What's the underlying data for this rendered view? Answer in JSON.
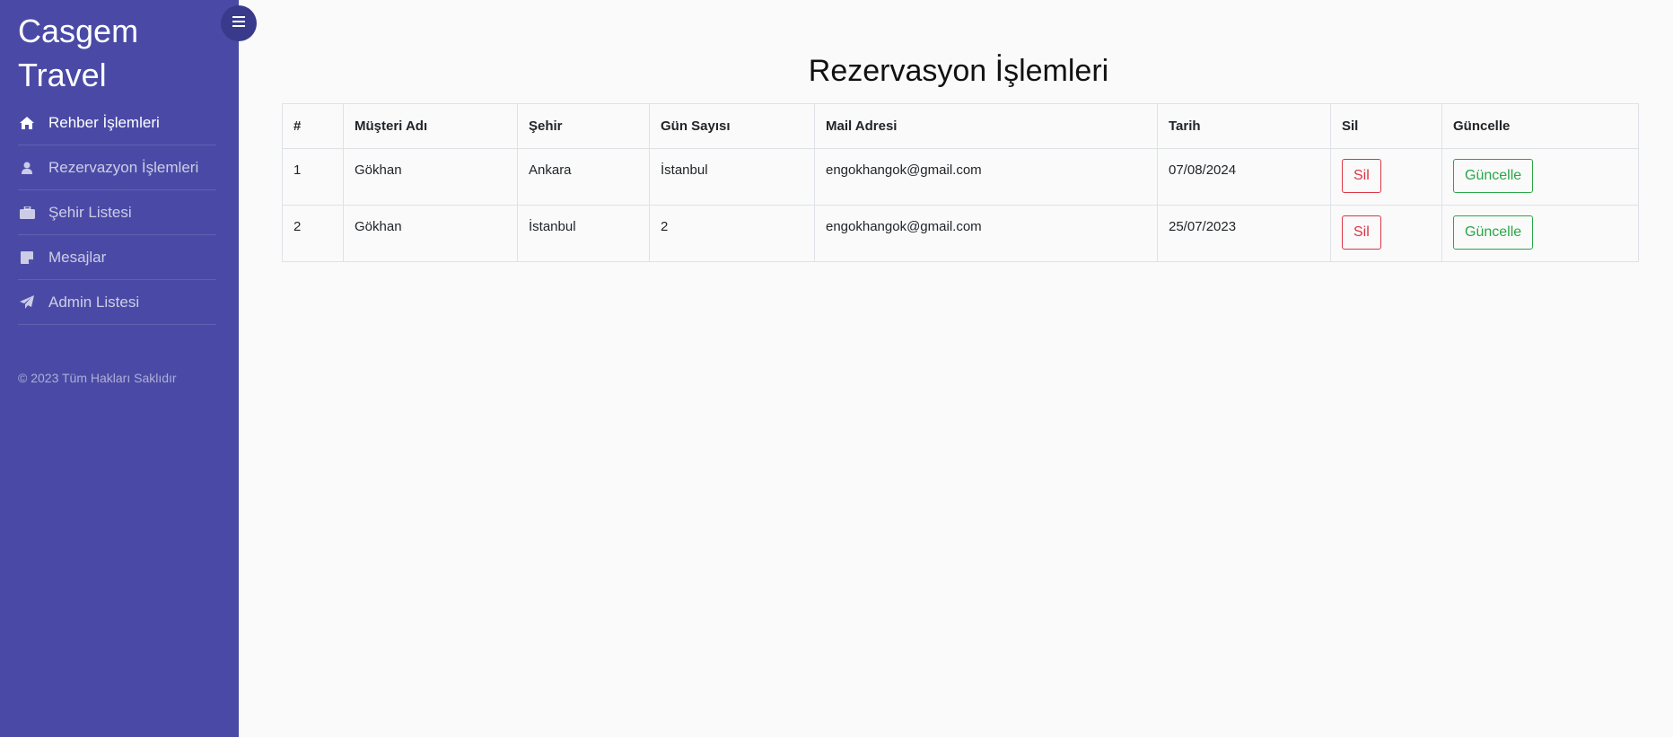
{
  "brand": {
    "line1": "Casgem",
    "line2": "Travel"
  },
  "nav": [
    {
      "label": "Rehber İşlemleri",
      "icon": "home-icon"
    },
    {
      "label": "Rezervazyon İşlemleri",
      "icon": "user-icon"
    },
    {
      "label": "Şehir Listesi",
      "icon": "briefcase-icon"
    },
    {
      "label": "Mesajlar",
      "icon": "sticky-note-icon"
    },
    {
      "label": "Admin Listesi",
      "icon": "paper-plane-icon"
    }
  ],
  "footer": {
    "text": "© 2023 Tüm Hakları Saklıdır"
  },
  "toggle": {
    "icon": "menu-icon"
  },
  "page": {
    "title": "Rezervasyon İşlemleri"
  },
  "table": {
    "headers": [
      "#",
      "Müşteri Adı",
      "Şehir",
      "Gün Sayısı",
      "Mail Adresi",
      "Tarih",
      "Sil",
      "Güncelle"
    ],
    "rows": [
      {
        "id": "1",
        "name": "Gökhan",
        "city": "Ankara",
        "days": "İstanbul",
        "mail": "engokhangok@gmail.com",
        "date": "07/08/2024",
        "delete": "Sil",
        "update": "Güncelle"
      },
      {
        "id": "2",
        "name": "Gökhan",
        "city": "İstanbul",
        "days": "2",
        "mail": "engokhangok@gmail.com",
        "date": "25/07/2023",
        "delete": "Sil",
        "update": "Güncelle"
      }
    ]
  },
  "colors": {
    "sidebar": "#4a4aa6",
    "toggle": "#3a3a8c",
    "danger": "#dc3545",
    "success": "#28a745",
    "background": "#fafafa"
  }
}
